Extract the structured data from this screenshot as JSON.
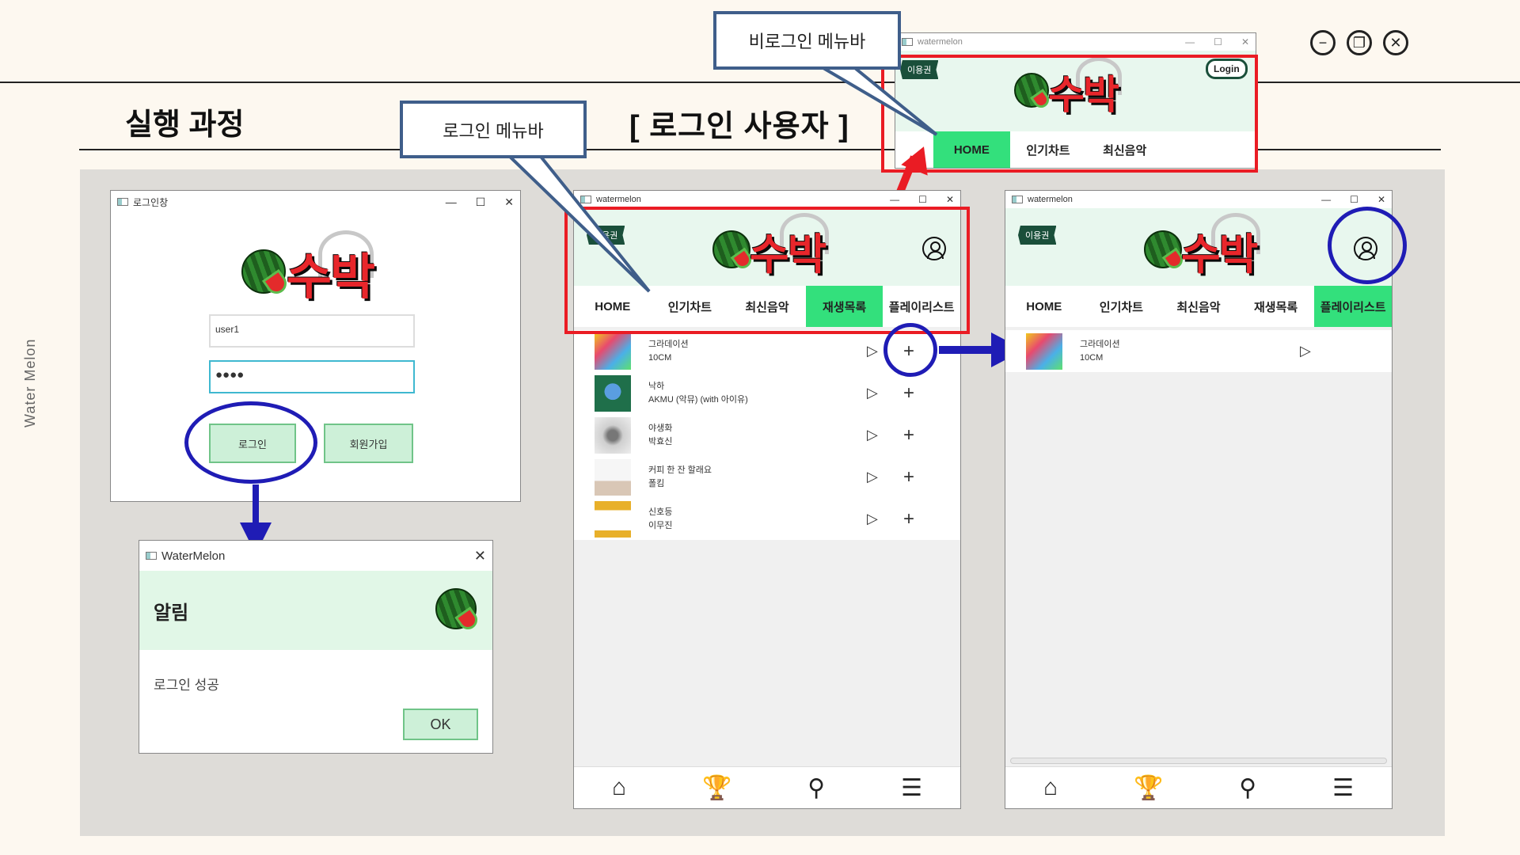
{
  "header": {
    "slide_title": "실행 과정",
    "section_title": "[ 로그인 사용자 ]",
    "side_label": "Water Melon"
  },
  "window_controls": [
    "minimize-circle",
    "restore-circle",
    "close-circle"
  ],
  "callouts": {
    "guest_menubar": "비로그인 메뉴바",
    "login_menubar": "로그인 메뉴바"
  },
  "login_window": {
    "title": "로그인창",
    "logo_text": "수박",
    "username_value": "user1",
    "password_value": "●●●●",
    "login_button": "로그인",
    "signup_button": "회원가입"
  },
  "alert_dialog": {
    "title": "WaterMelon",
    "heading": "알림",
    "message": "로그인 성공",
    "ok_button": "OK"
  },
  "guest_window": {
    "title": "watermelon",
    "tag": "이용권",
    "login_button": "Login",
    "nav": [
      "HOME",
      "인기차트",
      "최신음악"
    ],
    "active_nav": "HOME"
  },
  "main_window": {
    "title": "watermelon",
    "tag": "이용권",
    "nav": [
      "HOME",
      "인기차트",
      "최신음악",
      "재생목록",
      "플레이리스트"
    ],
    "active_nav": "재생목록",
    "songs": [
      {
        "title": "그라데이션",
        "artist": "10CM"
      },
      {
        "title": "낙하",
        "artist": "AKMU (악뮤) (with 아이유)"
      },
      {
        "title": "야생화",
        "artist": "박효신"
      },
      {
        "title": "커피 한 잔 할래요",
        "artist": "폴킴"
      },
      {
        "title": "신호등",
        "artist": "이무진"
      }
    ],
    "play_symbol": "▷",
    "add_symbol": "+"
  },
  "playlist_window": {
    "title": "watermelon",
    "tag": "이용권",
    "nav": [
      "HOME",
      "인기차트",
      "최신음악",
      "재생목록",
      "플레이리스트"
    ],
    "active_nav": "플레이리스트",
    "songs": [
      {
        "title": "그라데이션",
        "artist": "10CM"
      }
    ],
    "play_symbol": "▷"
  },
  "bottom_bar_icons": [
    "home-icon",
    "trophy-icon",
    "search-icon",
    "list-icon"
  ],
  "colors": {
    "accent_green": "#33e07c",
    "header_mint": "#e8f7ee",
    "callout_red": "#ea1c24",
    "callout_blue": "#1f1cb5"
  }
}
